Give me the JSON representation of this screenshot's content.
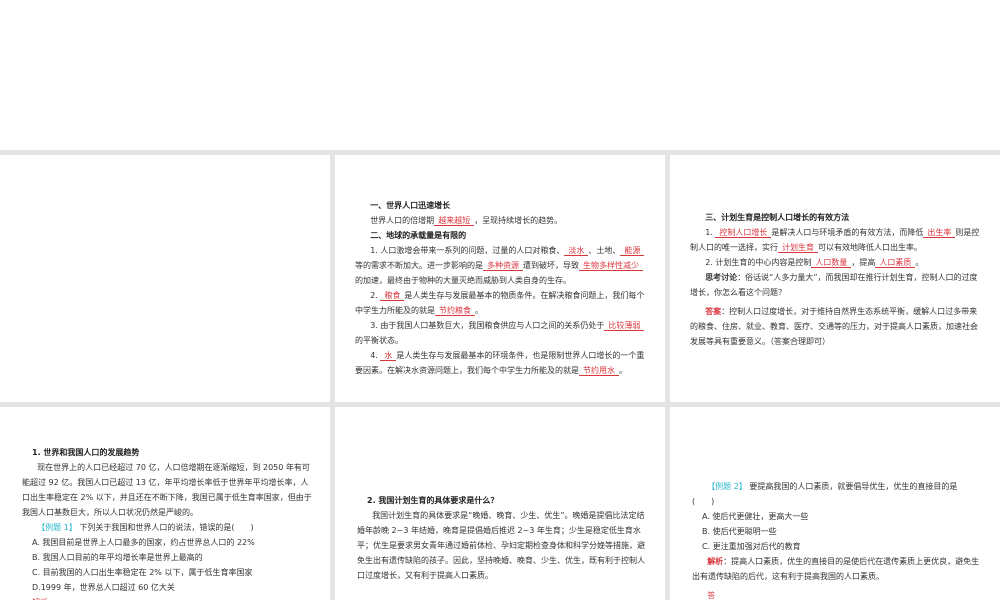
{
  "p2": {
    "h1": "一、世界人口迅速增长",
    "l1": [
      {
        "t": "世界人口的倍增期"
      },
      {
        "b": "越来越短"
      },
      {
        "t": "，呈现持续增长的趋势。"
      }
    ],
    "h2": "二、地球的承载量是有限的",
    "l2": [
      {
        "t": "1. 人口激增会带来一系列的问题，过量的人口对粮食、"
      },
      {
        "b": "淡水"
      },
      {
        "t": "、土地、"
      },
      {
        "b": "能源"
      },
      {
        "t": "等的需求不断加大。进一步影响的是"
      },
      {
        "b": "多种资源"
      },
      {
        "t": "遭到破坏，导致"
      },
      {
        "b": "生物多样性减少"
      },
      {
        "t": "的加速，最终由于物种的大量灭绝而威胁到人类自身的生存。"
      }
    ],
    "l3": [
      {
        "t": "2. "
      },
      {
        "b": "粮食"
      },
      {
        "t": "是人类生存与发展最基本的物质条件。在解决粮食问题上，我们每个中学生力所能及的就是"
      },
      {
        "b": "节约粮食"
      },
      {
        "t": "。"
      }
    ],
    "l4": [
      {
        "t": "3. 由于我国人口基数巨大，我国粮食供应与人口之间的关系仍处于"
      },
      {
        "b": "比较薄弱"
      },
      {
        "t": "的平衡状态。"
      }
    ],
    "l5": [
      {
        "t": "4. "
      },
      {
        "b": "水"
      },
      {
        "t": "是人类生存与发展最基本的环境条件，也是限制世界人口增长的一个重要因素。在解决水资源问题上，我们每个中学生力所能及的就是"
      },
      {
        "b": "节约用水"
      },
      {
        "t": "。"
      }
    ]
  },
  "p3": {
    "h1": "三、计划生育是控制人口增长的有效方法",
    "l1": [
      {
        "t": "1. "
      },
      {
        "b": "控制人口增长"
      },
      {
        "t": "是解决人口与环境矛盾的有效方法，而降低"
      },
      {
        "b": "出生率"
      },
      {
        "t": "则是控制人口的唯一选择，实行"
      },
      {
        "b": "计划生育"
      },
      {
        "t": "可以有效地降低人口出生率。"
      }
    ],
    "l2": [
      {
        "t": "2. 计划生育的中心内容是控制"
      },
      {
        "b": "人口数量"
      },
      {
        "t": "，提高"
      },
      {
        "b": "人口素质"
      },
      {
        "t": "。"
      }
    ],
    "think_label": "思考讨论",
    "think": "：俗话说“人多力量大”，而我国却在推行计划生育，控制人口的过度增长，你怎么看这个问题？",
    "answer_label": "答案",
    "answer": "：控制人口过度增长，对于维持自然界生态系统平衡，缓解人口过多带来的粮食、住房、就业、教育、医疗、交通等的压力，对于提高人口素质，加速社会发展等具有重要意义。（答案合理即可）"
  },
  "p4": {
    "h1": "1. 世界和我国人口的发展趋势",
    "body": "现在世界上的人口已经超过 70 亿，人口倍增期在逐渐缩短，到 2050 年有可能超过 92 亿。我国人口已超过 13 亿，年平均增长率低于世界年平均增长率，人口出生率稳定在 2% 以下，并且还在不断下降，我国已属于低生育率国家，但由于我国人口基数巨大，所以人口状况仍然是严峻的。",
    "ex_label": "【例题 1】",
    "ex_q": "下列关于我国和世界人口的说法，错误的是(　　)",
    "options": [
      "A. 我国目前是世界上人口最多的国家，约占世界总人口的 22%",
      "B. 我国人口目前的年平均增长率是世界上最高的",
      "C. 目前我国的人口出生率稳定在 2% 以下，属于低生育率国家",
      "D.1999 年，世界总人口超过 60 亿大关"
    ],
    "cut": "解析"
  },
  "p5": {
    "h1": "2. 我国计划生育的具体要求是什么？",
    "body": "我国计划生育的具体要求是“晚婚、晚育、少生、优生”。晚婚是提倡比法定结婚年龄晚 2~3 年结婚，晚育是提倡婚后推迟 2~3 年生育；少生是稳定低生育水平；优生是要求男女青年通过婚前体检、孕妇定期检查身体和科学分娩等措施，避免生出有遗传缺陷的孩子。因此，坚持晚婚、晚育、少生、优生，既有利于控制人口过度增长，又有利于提高人口素质。"
  },
  "p6": {
    "ex_label": "【例题 2】",
    "ex_q": "要提高我国的人口素质，就要倡导优生，优生的直接目的是",
    "paren": "(　　)",
    "options": [
      "A. 使后代更健壮，更高大一些",
      "B. 使后代更聪明一些",
      "C. 更注重加强对后代的教育"
    ],
    "analysis_label": "解析",
    "analysis": "：提高人口素质，优生的直接目的是使后代在遗传素质上更优良，避免生出有遗传缺陷的后代，这有利于提高我国的人口素质。",
    "answer_label": "答"
  }
}
